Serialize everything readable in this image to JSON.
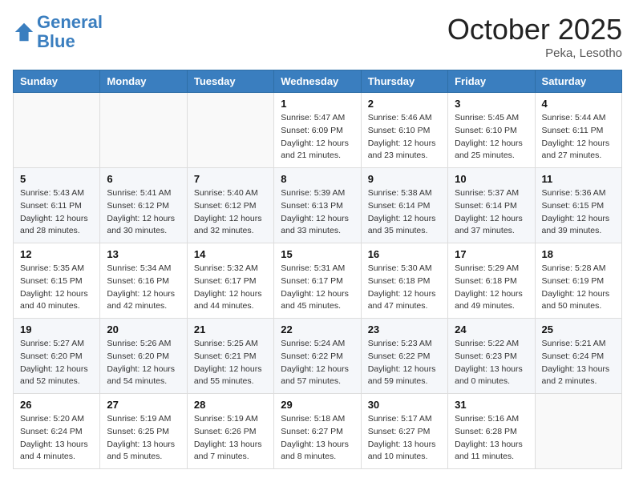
{
  "header": {
    "logo_line1": "General",
    "logo_line2": "Blue",
    "month": "October 2025",
    "location": "Peka, Lesotho"
  },
  "weekdays": [
    "Sunday",
    "Monday",
    "Tuesday",
    "Wednesday",
    "Thursday",
    "Friday",
    "Saturday"
  ],
  "weeks": [
    [
      {
        "day": "",
        "info": ""
      },
      {
        "day": "",
        "info": ""
      },
      {
        "day": "",
        "info": ""
      },
      {
        "day": "1",
        "info": "Sunrise: 5:47 AM\nSunset: 6:09 PM\nDaylight: 12 hours\nand 21 minutes."
      },
      {
        "day": "2",
        "info": "Sunrise: 5:46 AM\nSunset: 6:10 PM\nDaylight: 12 hours\nand 23 minutes."
      },
      {
        "day": "3",
        "info": "Sunrise: 5:45 AM\nSunset: 6:10 PM\nDaylight: 12 hours\nand 25 minutes."
      },
      {
        "day": "4",
        "info": "Sunrise: 5:44 AM\nSunset: 6:11 PM\nDaylight: 12 hours\nand 27 minutes."
      }
    ],
    [
      {
        "day": "5",
        "info": "Sunrise: 5:43 AM\nSunset: 6:11 PM\nDaylight: 12 hours\nand 28 minutes."
      },
      {
        "day": "6",
        "info": "Sunrise: 5:41 AM\nSunset: 6:12 PM\nDaylight: 12 hours\nand 30 minutes."
      },
      {
        "day": "7",
        "info": "Sunrise: 5:40 AM\nSunset: 6:12 PM\nDaylight: 12 hours\nand 32 minutes."
      },
      {
        "day": "8",
        "info": "Sunrise: 5:39 AM\nSunset: 6:13 PM\nDaylight: 12 hours\nand 33 minutes."
      },
      {
        "day": "9",
        "info": "Sunrise: 5:38 AM\nSunset: 6:14 PM\nDaylight: 12 hours\nand 35 minutes."
      },
      {
        "day": "10",
        "info": "Sunrise: 5:37 AM\nSunset: 6:14 PM\nDaylight: 12 hours\nand 37 minutes."
      },
      {
        "day": "11",
        "info": "Sunrise: 5:36 AM\nSunset: 6:15 PM\nDaylight: 12 hours\nand 39 minutes."
      }
    ],
    [
      {
        "day": "12",
        "info": "Sunrise: 5:35 AM\nSunset: 6:15 PM\nDaylight: 12 hours\nand 40 minutes."
      },
      {
        "day": "13",
        "info": "Sunrise: 5:34 AM\nSunset: 6:16 PM\nDaylight: 12 hours\nand 42 minutes."
      },
      {
        "day": "14",
        "info": "Sunrise: 5:32 AM\nSunset: 6:17 PM\nDaylight: 12 hours\nand 44 minutes."
      },
      {
        "day": "15",
        "info": "Sunrise: 5:31 AM\nSunset: 6:17 PM\nDaylight: 12 hours\nand 45 minutes."
      },
      {
        "day": "16",
        "info": "Sunrise: 5:30 AM\nSunset: 6:18 PM\nDaylight: 12 hours\nand 47 minutes."
      },
      {
        "day": "17",
        "info": "Sunrise: 5:29 AM\nSunset: 6:18 PM\nDaylight: 12 hours\nand 49 minutes."
      },
      {
        "day": "18",
        "info": "Sunrise: 5:28 AM\nSunset: 6:19 PM\nDaylight: 12 hours\nand 50 minutes."
      }
    ],
    [
      {
        "day": "19",
        "info": "Sunrise: 5:27 AM\nSunset: 6:20 PM\nDaylight: 12 hours\nand 52 minutes."
      },
      {
        "day": "20",
        "info": "Sunrise: 5:26 AM\nSunset: 6:20 PM\nDaylight: 12 hours\nand 54 minutes."
      },
      {
        "day": "21",
        "info": "Sunrise: 5:25 AM\nSunset: 6:21 PM\nDaylight: 12 hours\nand 55 minutes."
      },
      {
        "day": "22",
        "info": "Sunrise: 5:24 AM\nSunset: 6:22 PM\nDaylight: 12 hours\nand 57 minutes."
      },
      {
        "day": "23",
        "info": "Sunrise: 5:23 AM\nSunset: 6:22 PM\nDaylight: 12 hours\nand 59 minutes."
      },
      {
        "day": "24",
        "info": "Sunrise: 5:22 AM\nSunset: 6:23 PM\nDaylight: 13 hours\nand 0 minutes."
      },
      {
        "day": "25",
        "info": "Sunrise: 5:21 AM\nSunset: 6:24 PM\nDaylight: 13 hours\nand 2 minutes."
      }
    ],
    [
      {
        "day": "26",
        "info": "Sunrise: 5:20 AM\nSunset: 6:24 PM\nDaylight: 13 hours\nand 4 minutes."
      },
      {
        "day": "27",
        "info": "Sunrise: 5:19 AM\nSunset: 6:25 PM\nDaylight: 13 hours\nand 5 minutes."
      },
      {
        "day": "28",
        "info": "Sunrise: 5:19 AM\nSunset: 6:26 PM\nDaylight: 13 hours\nand 7 minutes."
      },
      {
        "day": "29",
        "info": "Sunrise: 5:18 AM\nSunset: 6:27 PM\nDaylight: 13 hours\nand 8 minutes."
      },
      {
        "day": "30",
        "info": "Sunrise: 5:17 AM\nSunset: 6:27 PM\nDaylight: 13 hours\nand 10 minutes."
      },
      {
        "day": "31",
        "info": "Sunrise: 5:16 AM\nSunset: 6:28 PM\nDaylight: 13 hours\nand 11 minutes."
      },
      {
        "day": "",
        "info": ""
      }
    ]
  ]
}
